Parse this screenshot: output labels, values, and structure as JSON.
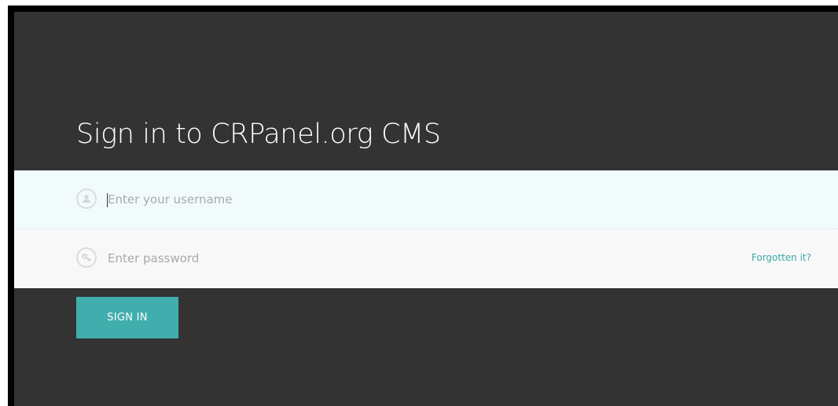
{
  "page": {
    "title": "Sign in to CRPanel.org CMS"
  },
  "form": {
    "username": {
      "value": "",
      "placeholder": "Enter your username",
      "icon": "user-icon"
    },
    "password": {
      "value": "",
      "placeholder": "Enter password",
      "icon": "key-icon"
    },
    "forgot_label": "Forgotten it?",
    "submit_label": "SIGN IN"
  },
  "colors": {
    "panel_background": "#333333",
    "username_field_background": "#f2fbfb",
    "password_field_background": "#f8f8f8",
    "accent": "#40aeac",
    "link": "#3aa9a8"
  }
}
